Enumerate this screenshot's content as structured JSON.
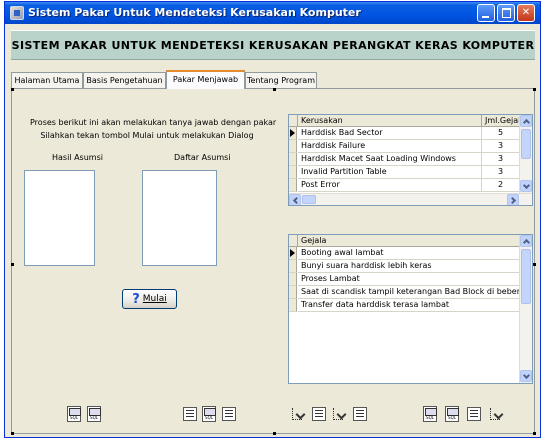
{
  "window": {
    "title": "Sistem Pakar Untuk Mendeteksi Kerusakan Komputer",
    "icon": "app-icon",
    "controls": [
      "minimize-icon",
      "maximize-icon",
      "close-icon"
    ]
  },
  "banner": {
    "title": "SISTEM PAKAR UNTUK MENDETEKSI KERUSAKAN PERANGKAT KERAS KOMPUTER",
    "background": "#b9d3cb"
  },
  "tabs": [
    {
      "label": "Halaman Utama",
      "active": false
    },
    {
      "label": "Basis Pengetahuan",
      "active": false
    },
    {
      "label": "Pakar Menjawab",
      "active": true
    },
    {
      "label": "Tentang Program",
      "active": false
    }
  ],
  "left_panel": {
    "info_line1": "Proses berikut ini akan melakukan tanya jawab dengan pakar",
    "info_line2": "Silahkan tekan tombol Mulai untuk melakukan Dialog",
    "hasil_label": "Hasil Asumsi",
    "daftar_label": "Daftar Asumsi",
    "mulai_prefix": "?",
    "mulai_label": "Mulai"
  },
  "kerusakan_grid": {
    "col_name": "Kerusakan",
    "col_count": "Jml.Gejala",
    "rows": [
      {
        "name": "Harddisk Bad Sector",
        "count": "5",
        "current": true
      },
      {
        "name": "Harddisk Failure",
        "count": "3",
        "current": false
      },
      {
        "name": "Harddisk Macet Saat Loading Windows",
        "count": "3",
        "current": false
      },
      {
        "name": "Invalid Partition Table",
        "count": "3",
        "current": false
      },
      {
        "name": "Post Error",
        "count": "2",
        "current": false
      }
    ]
  },
  "gejala_grid": {
    "col_name": "Gejala",
    "rows": [
      {
        "name": "Booting awal lambat",
        "current": true
      },
      {
        "name": "Bunyi suara harddisk lebih keras",
        "current": false
      },
      {
        "name": "Proses Lambat",
        "current": false
      },
      {
        "name": "Saat di scandisk tampil keterangan Bad Block di beberapa sektor",
        "current": false
      },
      {
        "name": "Transfer data harddisk terasa lambat",
        "current": false
      }
    ]
  },
  "toolbar_icons": [
    "sql-query-icon",
    "sql-query-icon",
    "grid-view-icon",
    "sql-query-icon",
    "grid-view-icon",
    "relation-tool-icon",
    "grid-view-icon",
    "relation-tool-icon",
    "grid-view-icon",
    "sql-query-icon",
    "sql-query-icon",
    "grid-view-icon",
    "relation-tool-icon"
  ]
}
